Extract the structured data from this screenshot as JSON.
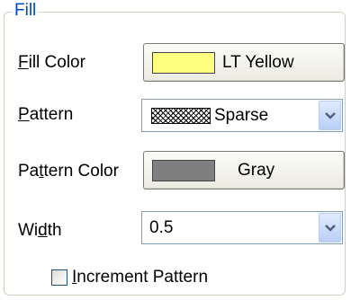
{
  "group": {
    "title": "Fill"
  },
  "fill_color": {
    "label_pre": "",
    "label_mnemonic": "F",
    "label_post": "ill Color",
    "button_text": "LT Yellow",
    "swatch_color": "#ffff80"
  },
  "pattern": {
    "label_pre": "",
    "label_mnemonic": "P",
    "label_post": "attern",
    "selected": "Sparse",
    "dropdown_icon": "chevron-down-icon"
  },
  "pattern_color": {
    "label_pre": "Pa",
    "label_mnemonic": "t",
    "label_post": "tern Color",
    "button_text": "Gray",
    "swatch_color": "#7f7f7f"
  },
  "width": {
    "label_pre": "Wi",
    "label_mnemonic": "d",
    "label_post": "th",
    "selected": "0.5",
    "dropdown_icon": "chevron-down-icon"
  },
  "increment": {
    "label_pre": "",
    "label_mnemonic": "I",
    "label_post": "ncrement Pattern",
    "checked": false
  }
}
